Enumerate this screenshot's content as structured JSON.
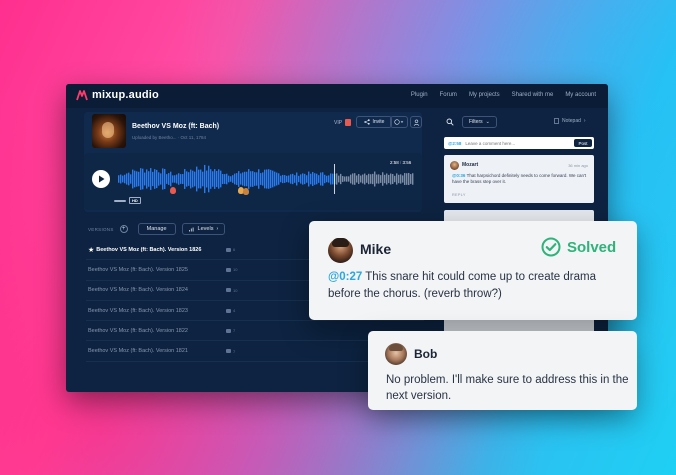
{
  "app": {
    "logo_text": "mixup.audio",
    "nav": [
      "Plugin",
      "Forum",
      "My projects",
      "Shared with me",
      "My account"
    ]
  },
  "track": {
    "title": "Beethov VS Moz (ft: Bach)",
    "subtitle": "Uploaded by Beetho... · Oct 11, 1784",
    "vip_label": "VIP",
    "invite_label": "Invite",
    "time_current": "2:58",
    "time_total": "3:56",
    "hd_label": "HD",
    "progress_fraction": 0.73
  },
  "versions": {
    "label": "VERSIONS",
    "add_label": "+",
    "manage_label": "Manage",
    "levels_label": "Levels",
    "items": [
      {
        "name": "Beethov VS Moz (ft: Bach). Version 1826",
        "comments": "6",
        "current": true
      },
      {
        "name": "Beethov VS Moz (ft: Bach). Version 1825",
        "comments": "10",
        "current": false
      },
      {
        "name": "Beethov VS Moz (ft: Bach). Version 1824",
        "comments": "10",
        "current": false
      },
      {
        "name": "Beethov VS Moz (ft: Bach). Version 1823",
        "comments": "4",
        "current": false
      },
      {
        "name": "Beethov VS Moz (ft: Bach). Version 1822",
        "comments": "7",
        "current": false
      },
      {
        "name": "Beethov VS Moz (ft: Bach). Version 1821",
        "comments": "7",
        "current": false
      }
    ]
  },
  "comments_panel": {
    "filters_label": "Filters",
    "notepad_label": "Notepad",
    "input_timestamp": "@2:58",
    "input_placeholder": "Leave a comment here...",
    "post_label": "Post",
    "card": {
      "author": "Mozart",
      "time": "36 min ago",
      "timestamp": "@0:36",
      "text": " That harpsichord definitely needs to come forward. We can't have the brass step over it.",
      "reply_label": "REPLY"
    }
  },
  "mike_comment": {
    "author": "Mike",
    "status": "Solved",
    "timestamp": "@0:27",
    "text": " This snare hit could come up to create drama before the chorus. (reverb throw?)"
  },
  "bob_comment": {
    "author": "Bob",
    "text": "No problem. I'll make sure to address this in the  next version."
  },
  "colors": {
    "app_bg": "#0d2341",
    "accent_blue": "#2a7bf0",
    "timestamp_blue": "#2aa6e0",
    "solved_green": "#2fb37a",
    "logo_red": "#ff3b6b"
  }
}
